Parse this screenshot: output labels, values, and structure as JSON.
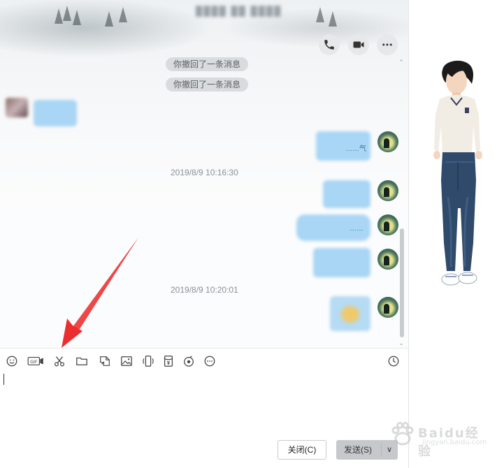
{
  "window": {
    "title": "████ ██ ████",
    "controls": {
      "dropdown": "▾",
      "minimize": "—",
      "maximize": "☐",
      "close": "✕"
    }
  },
  "header_actions": [
    {
      "icon": "phone-icon"
    },
    {
      "icon": "video-icon"
    },
    {
      "icon": "more-icon"
    }
  ],
  "messages": {
    "recall_1": "你撤回了一条消息",
    "recall_2": "你撤回了一条消息",
    "time_1": "2019/8/9 10:16:30",
    "time_2": "2019/8/9 10:20:01",
    "bubble_1_text": "……气",
    "bubble_3_text": "……"
  },
  "toolbar": [
    "emoji-icon",
    "gif-icon",
    "screenshot-scissors-icon",
    "folder-icon",
    "image-edit-icon",
    "picture-icon",
    "shake-window-icon",
    "red-packet-icon",
    "music-icon",
    "more-dots-icon",
    "history-clock-icon"
  ],
  "toolbar_labels": {
    "gif": "GIF"
  },
  "footer": {
    "close_label": "关闭(C)",
    "send_label": "发送(S)",
    "send_dropdown": "∨"
  },
  "watermark": {
    "brand": "Baidu经验",
    "url": "jingyan.baidu.com"
  },
  "colors": {
    "bubble": "#a9d6f5",
    "system_pill": "#d9dcde",
    "arrow": "#f03a3a",
    "send_button": "#c6c8cb"
  }
}
